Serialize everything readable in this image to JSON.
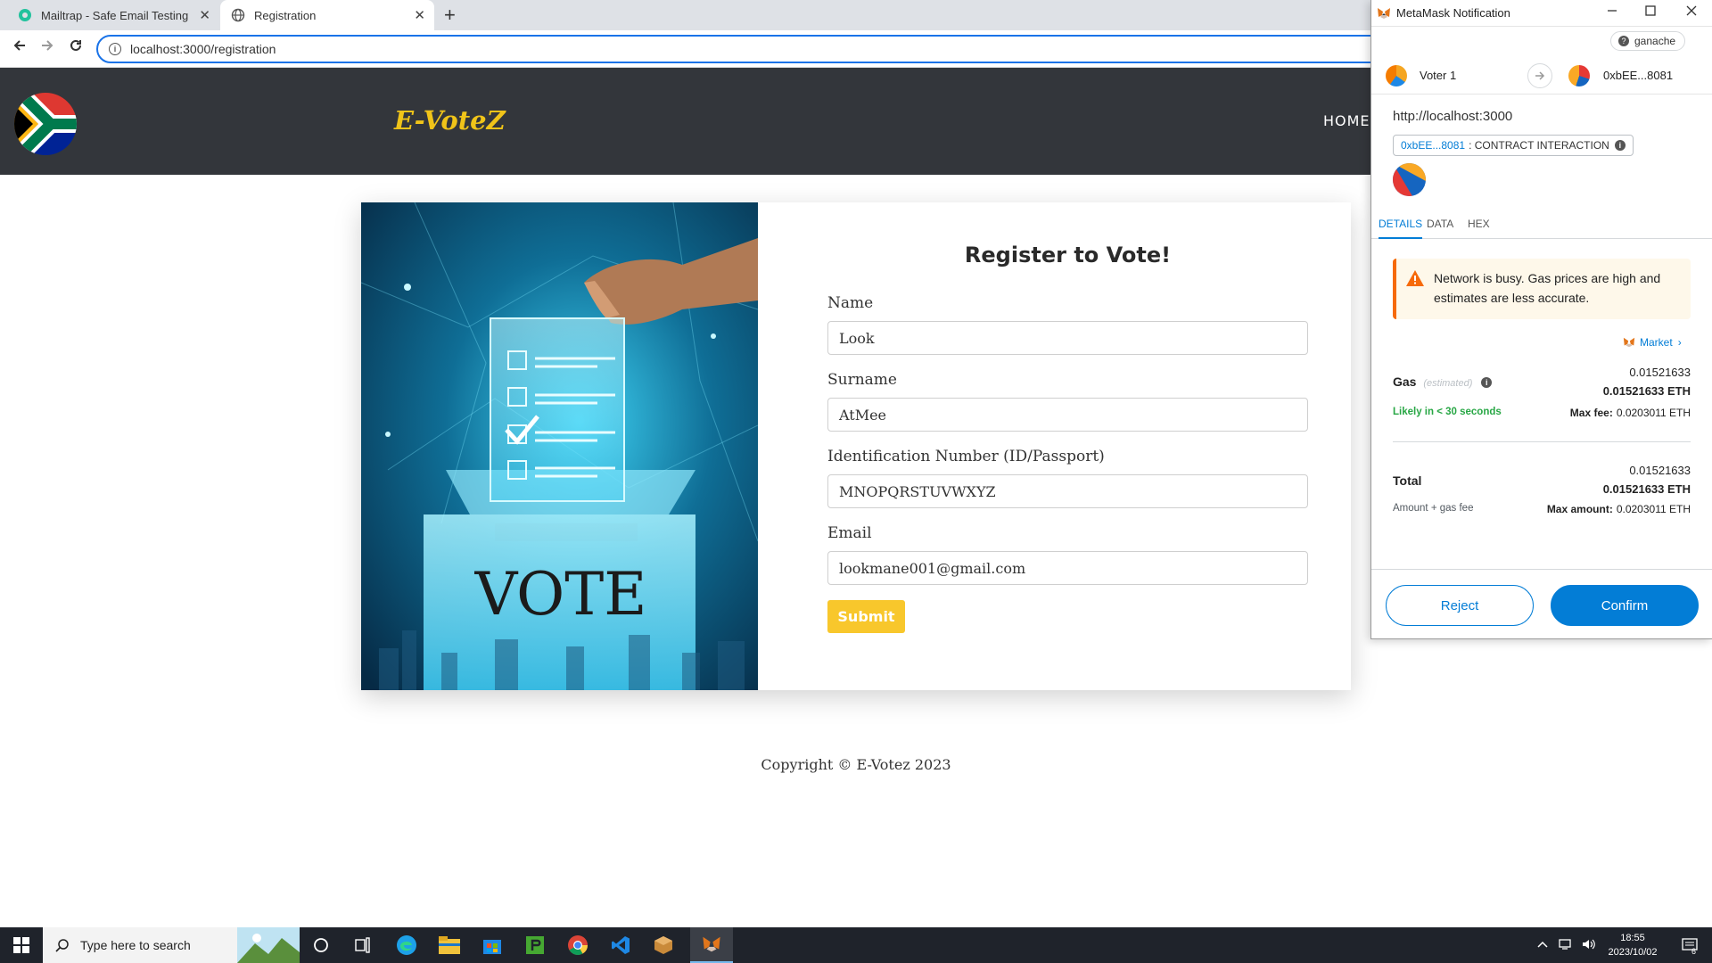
{
  "browser": {
    "tabs": [
      {
        "label": "Mailtrap - Safe Email Testing"
      },
      {
        "label": "Registration"
      }
    ],
    "new_tab_glyph": "+",
    "close_glyph": "✕",
    "url": "localhost:3000/registration"
  },
  "site": {
    "brand": "E-VoteZ",
    "nav_home": "HOME",
    "card": {
      "image_text": "VOTE",
      "title": "Register to Vote!",
      "fields": [
        {
          "label": "Name",
          "value": "Look"
        },
        {
          "label": "Surname",
          "value": "AtMee"
        },
        {
          "label": "Identification Number (ID/Passport)",
          "value": "MNOPQRSTUVWXYZ"
        },
        {
          "label": "Email",
          "value": "lookmane001@gmail.com"
        }
      ],
      "submit_label": "Submit"
    },
    "copyright": "Copyright © E-Votez 2023"
  },
  "metamask": {
    "window_title": "MetaMask Notification",
    "network": "ganache",
    "from_account": "Voter 1",
    "to_account": "0xbEE...8081",
    "origin": "http://localhost:3000",
    "contract_address": "0xbEE...8081",
    "contract_label": ": CONTRACT INTERACTION",
    "tabs": [
      "DETAILS",
      "DATA",
      "HEX"
    ],
    "warning": "Network is busy. Gas prices are high and estimates are less accurate.",
    "market_label": "Market",
    "gas": {
      "label": "Gas",
      "estimated": "(estimated)",
      "value_small": "0.01521633",
      "value_eth": "0.01521633 ETH",
      "likely": "Likely in < 30 seconds",
      "max_fee_label": "Max fee:",
      "max_fee_value": "0.0203011 ETH"
    },
    "total": {
      "label": "Total",
      "value_small": "0.01521633",
      "value_eth": "0.01521633 ETH",
      "sub": "Amount + gas fee",
      "max_amount_label": "Max amount:",
      "max_amount_value": "0.0203011 ETH"
    },
    "reject_label": "Reject",
    "confirm_label": "Confirm"
  },
  "taskbar": {
    "search_placeholder": "Type here to search",
    "time": "18:55",
    "date": "2023/10/02",
    "notification_count": "6"
  },
  "colors": {
    "header_bg": "#33363b",
    "brand": "#f0c419",
    "submit": "#f8c72c",
    "metamask_blue": "#037dd6"
  }
}
